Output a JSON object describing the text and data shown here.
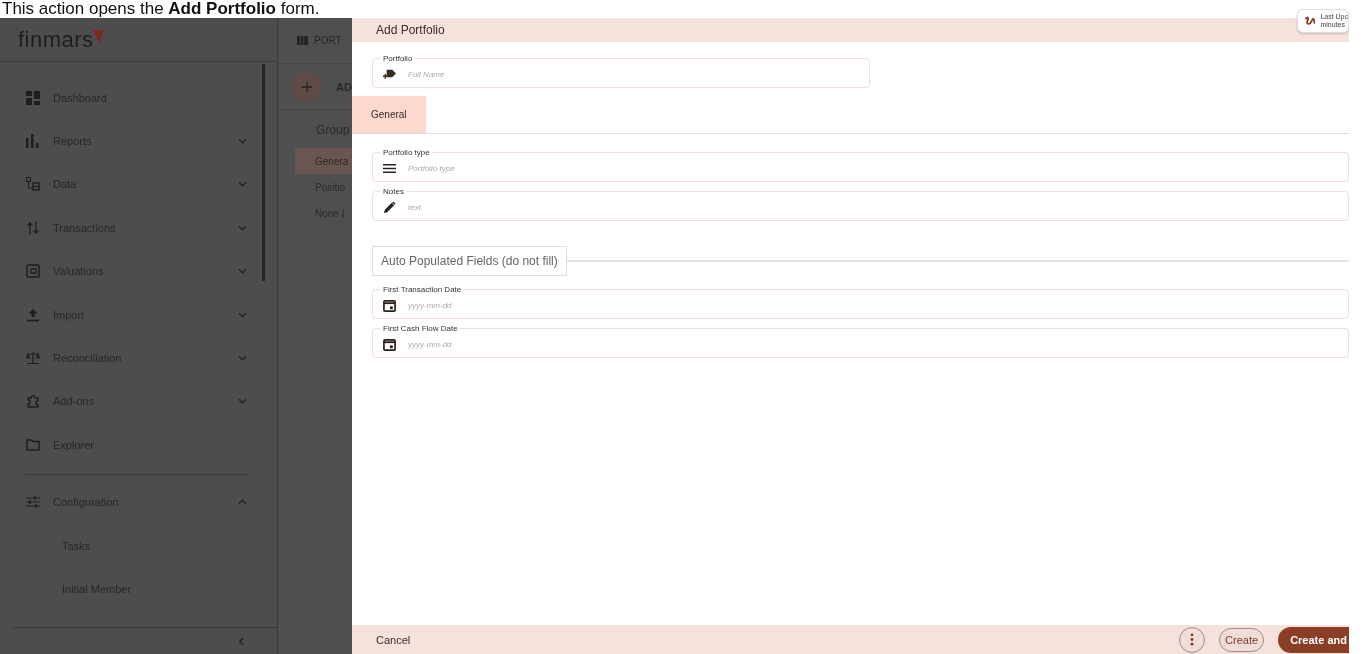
{
  "caption": "This action opens the **Add Portfolio** form.",
  "sidebar": {
    "logo": "finmars",
    "items": [
      {
        "label": "Dashboard",
        "kind": "link"
      },
      {
        "label": "Reports",
        "kind": "group",
        "expanded": false
      },
      {
        "label": "Data",
        "kind": "group",
        "expanded": false
      },
      {
        "label": "Transactions",
        "kind": "group",
        "expanded": false
      },
      {
        "label": "Valuations",
        "kind": "group",
        "expanded": false
      },
      {
        "label": "Import",
        "kind": "group",
        "expanded": false
      },
      {
        "label": "Reconciliation",
        "kind": "group",
        "expanded": false
      },
      {
        "label": "Add-ons",
        "kind": "group",
        "expanded": false
      },
      {
        "label": "Explorer",
        "kind": "link"
      }
    ],
    "bottom_items": [
      {
        "label": "Configuration",
        "kind": "group",
        "expanded": true,
        "children": [
          {
            "label": "Tasks"
          },
          {
            "label": "Initial Member"
          }
        ]
      }
    ]
  },
  "panel": {
    "title": "PORT",
    "add_label": "AD",
    "group_label": "Group",
    "groups": [
      {
        "label": "Genera",
        "selected": true
      },
      {
        "label": "Positio",
        "selected": false
      },
      {
        "label": "None (",
        "selected": false
      }
    ]
  },
  "dialog": {
    "title": "Add Portfolio",
    "status": [
      "Last Upc",
      "minutes"
    ],
    "name_field": {
      "label": "Portfolio",
      "placeholder": "Full Name"
    },
    "tabs": [
      {
        "label": "General",
        "selected": true
      }
    ],
    "fields": [
      {
        "label": "Portfolio type",
        "placeholder": "Portfolio type"
      },
      {
        "label": "Notes",
        "placeholder": "text"
      }
    ],
    "section": "Auto Populated Fields (do not fill)",
    "date_fields": [
      {
        "label": "First Transaction Date",
        "placeholder": "yyyy-mm-dd"
      },
      {
        "label": "First Cash Flow Date",
        "placeholder": "yyyy-mm-dd"
      }
    ],
    "footer": {
      "cancel": "Cancel",
      "create": "Create",
      "create_and": "Create and"
    }
  }
}
